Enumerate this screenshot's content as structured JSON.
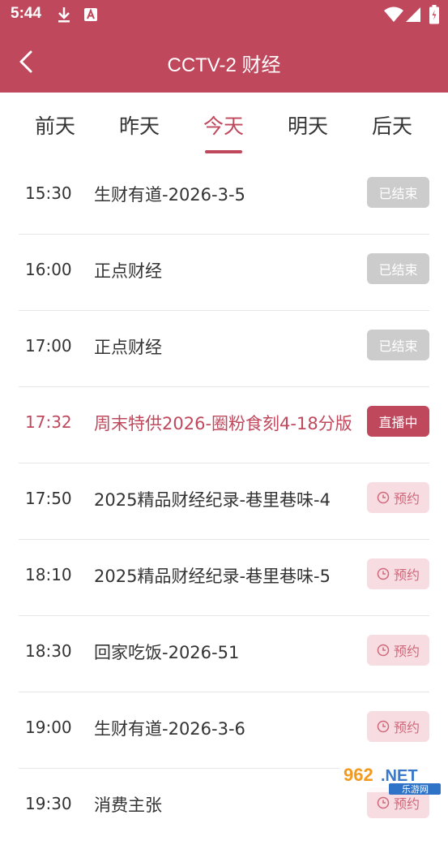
{
  "status_bar": {
    "time": "5:44"
  },
  "app_bar": {
    "title": "CCTV-2 财经"
  },
  "tabs": [
    {
      "label": "前天"
    },
    {
      "label": "昨天"
    },
    {
      "label": "今天"
    },
    {
      "label": "明天"
    },
    {
      "label": "后天"
    }
  ],
  "active_tab": "今天",
  "programs": [
    {
      "time": "15:30",
      "name": "生财有道-2026-3-5",
      "status": "已结束"
    },
    {
      "time": "16:00",
      "name": "正点财经",
      "status": "已结束"
    },
    {
      "time": "17:00",
      "name": "正点财经",
      "status": "已结束"
    },
    {
      "time": "17:32",
      "name": "周末特供2026-圈粉食刻4-18分版",
      "status": "直播中"
    },
    {
      "time": "17:50",
      "name": "2025精品财经纪录-巷里巷味-4",
      "status": "预约"
    },
    {
      "time": "18:10",
      "name": "2025精品财经纪录-巷里巷味-5",
      "status": "预约"
    },
    {
      "time": "18:30",
      "name": "回家吃饭-2026-51",
      "status": "预约"
    },
    {
      "time": "19:00",
      "name": "生财有道-2026-3-6",
      "status": "预约"
    },
    {
      "time": "19:30",
      "name": "消费主张",
      "status": "预约"
    }
  ],
  "watermark": {
    "brand": "962.NET",
    "sub": "乐游网"
  },
  "colors": {
    "accent": "#c0485d",
    "ended": "#cccccc",
    "reserve_bg": "#f7dde2",
    "reserve_fg": "#d0687a"
  }
}
